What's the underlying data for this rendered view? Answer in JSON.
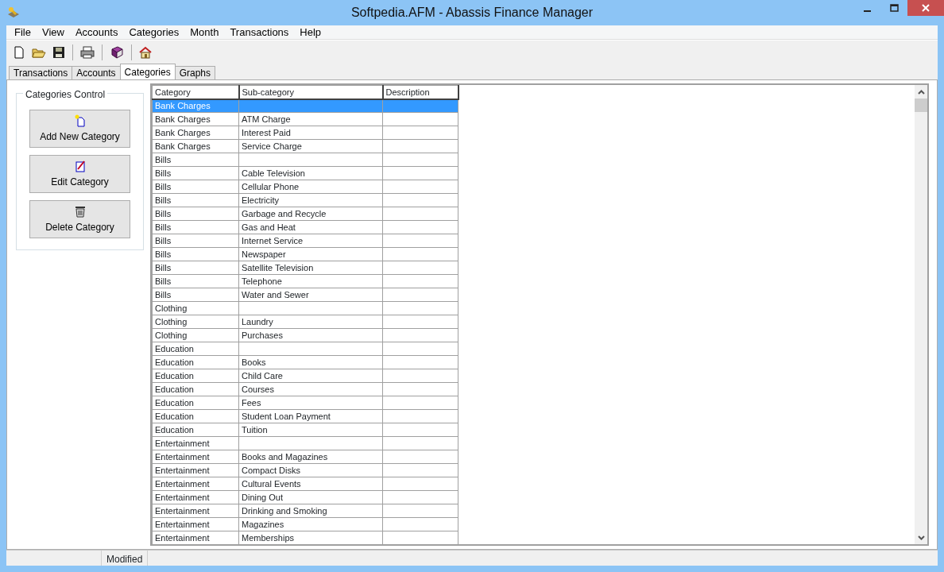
{
  "window": {
    "title": "Softpedia.AFM - Abassis Finance Manager"
  },
  "menu": [
    "File",
    "View",
    "Accounts",
    "Categories",
    "Month",
    "Transactions",
    "Help"
  ],
  "tabs": [
    {
      "label": "Transactions",
      "selected": false
    },
    {
      "label": "Accounts",
      "selected": false
    },
    {
      "label": "Categories",
      "selected": true
    },
    {
      "label": "Graphs",
      "selected": false
    }
  ],
  "control_group": {
    "title": "Categories Control",
    "buttons": [
      {
        "label": "Add New Category",
        "kind": "add"
      },
      {
        "label": "Edit Category",
        "kind": "edit"
      },
      {
        "label": "Delete Category",
        "kind": "delete"
      }
    ]
  },
  "table": {
    "columns": [
      "Category",
      "Sub-category",
      "Description"
    ],
    "rows": [
      {
        "category": "Bank Charges",
        "selected": true
      },
      {
        "category": "Bank Charges",
        "subcategory": "ATM Charge",
        "selected": false
      },
      {
        "category": "Bank Charges",
        "subcategory": "Interest Paid",
        "selected": false
      },
      {
        "category": "Bank Charges",
        "subcategory": "Service Charge",
        "selected": false
      },
      {
        "category": "Bills",
        "selected": false
      },
      {
        "category": "Bills",
        "subcategory": "Cable Television",
        "selected": false
      },
      {
        "category": "Bills",
        "subcategory": "Cellular Phone",
        "selected": false
      },
      {
        "category": "Bills",
        "subcategory": "Electricity",
        "selected": false
      },
      {
        "category": "Bills",
        "subcategory": "Garbage and Recycle",
        "selected": false
      },
      {
        "category": "Bills",
        "subcategory": "Gas and Heat",
        "selected": false
      },
      {
        "category": "Bills",
        "subcategory": "Internet Service",
        "selected": false
      },
      {
        "category": "Bills",
        "subcategory": "Newspaper",
        "selected": false
      },
      {
        "category": "Bills",
        "subcategory": "Satellite Television",
        "selected": false
      },
      {
        "category": "Bills",
        "subcategory": "Telephone",
        "selected": false
      },
      {
        "category": "Bills",
        "subcategory": "Water and Sewer",
        "selected": false
      },
      {
        "category": "Clothing",
        "selected": false
      },
      {
        "category": "Clothing",
        "subcategory": "Laundry",
        "selected": false
      },
      {
        "category": "Clothing",
        "subcategory": "Purchases",
        "selected": false
      },
      {
        "category": "Education",
        "selected": false
      },
      {
        "category": "Education",
        "subcategory": "Books",
        "selected": false
      },
      {
        "category": "Education",
        "subcategory": "Child Care",
        "selected": false
      },
      {
        "category": "Education",
        "subcategory": "Courses",
        "selected": false
      },
      {
        "category": "Education",
        "subcategory": "Fees",
        "selected": false
      },
      {
        "category": "Education",
        "subcategory": "Student Loan Payment",
        "selected": false
      },
      {
        "category": "Education",
        "subcategory": "Tuition",
        "selected": false
      },
      {
        "category": "Entertainment",
        "selected": false
      },
      {
        "category": "Entertainment",
        "subcategory": "Books and Magazines",
        "selected": false
      },
      {
        "category": "Entertainment",
        "subcategory": "Compact Disks",
        "selected": false
      },
      {
        "category": "Entertainment",
        "subcategory": "Cultural Events",
        "selected": false
      },
      {
        "category": "Entertainment",
        "subcategory": "Dining Out",
        "selected": false
      },
      {
        "category": "Entertainment",
        "subcategory": "Drinking and Smoking",
        "selected": false
      },
      {
        "category": "Entertainment",
        "subcategory": "Magazines",
        "selected": false
      },
      {
        "category": "Entertainment",
        "subcategory": "Memberships",
        "selected": false
      }
    ]
  },
  "status_bar": {
    "text": "Modified"
  }
}
